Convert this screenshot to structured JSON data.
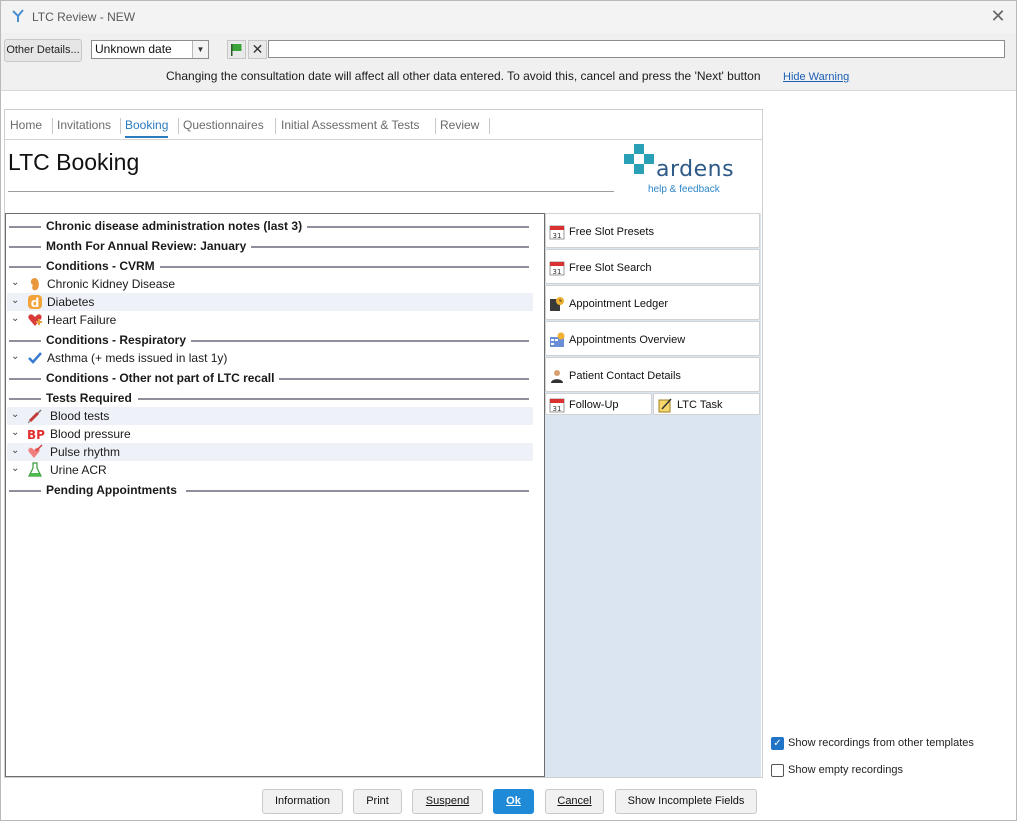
{
  "window": {
    "title": "LTC Review - NEW"
  },
  "toolbar": {
    "other_details": "Other Details...",
    "date_value": "Unknown date",
    "warning": "Changing the consultation date will affect all other data entered. To avoid this, cancel and press the 'Next' button",
    "hide_warning": "Hide Warning"
  },
  "tabs": [
    "Home",
    "Invitations",
    "Booking",
    "Questionnaires",
    "Initial Assessment & Tests",
    "Review"
  ],
  "active_tab": "Booking",
  "page": {
    "title": "LTC Booking"
  },
  "logo": {
    "word": "ardens",
    "help": "help & feedback"
  },
  "sections": {
    "admin_notes": "Chronic disease administration notes (last 3)",
    "month_review": "Month For Annual Review: January",
    "cvrm": "Conditions - CVRM",
    "respiratory": "Conditions - Respiratory",
    "other": "Conditions - Other not part of LTC recall",
    "tests": "Tests Required",
    "pending": "Pending Appointments"
  },
  "conditions": {
    "ckd": "Chronic Kidney Disease",
    "diabetes": "Diabetes",
    "heart_failure": "Heart Failure",
    "asthma": "Asthma (+ meds issued in last 1y)"
  },
  "tests": {
    "blood_tests": "Blood tests",
    "blood_pressure": "Blood pressure",
    "pulse_rhythm": "Pulse rhythm",
    "urine_acr": "Urine ACR"
  },
  "side_buttons": {
    "free_slot_presets": "Free Slot Presets",
    "free_slot_search": "Free Slot Search",
    "appointment_ledger": "Appointment Ledger",
    "appointments_overview": "Appointments Overview",
    "patient_contact_details": "Patient Contact Details",
    "follow_up": "Follow-Up",
    "ltc_task": "LTC Task"
  },
  "options": {
    "show_other_templates": "Show recordings from other templates",
    "show_other_templates_checked": true,
    "show_empty": "Show empty recordings",
    "show_empty_checked": false
  },
  "footer": {
    "information": "Information",
    "print": "Print",
    "suspend": "Suspend",
    "ok": "Ok",
    "cancel": "Cancel",
    "show_incomplete": "Show Incomplete Fields"
  },
  "colors": {
    "accent": "#2b7bbf",
    "primary_button": "#1e8ad8",
    "button_panel": "#dbe5f1",
    "row_alt": "#eef1f8"
  }
}
